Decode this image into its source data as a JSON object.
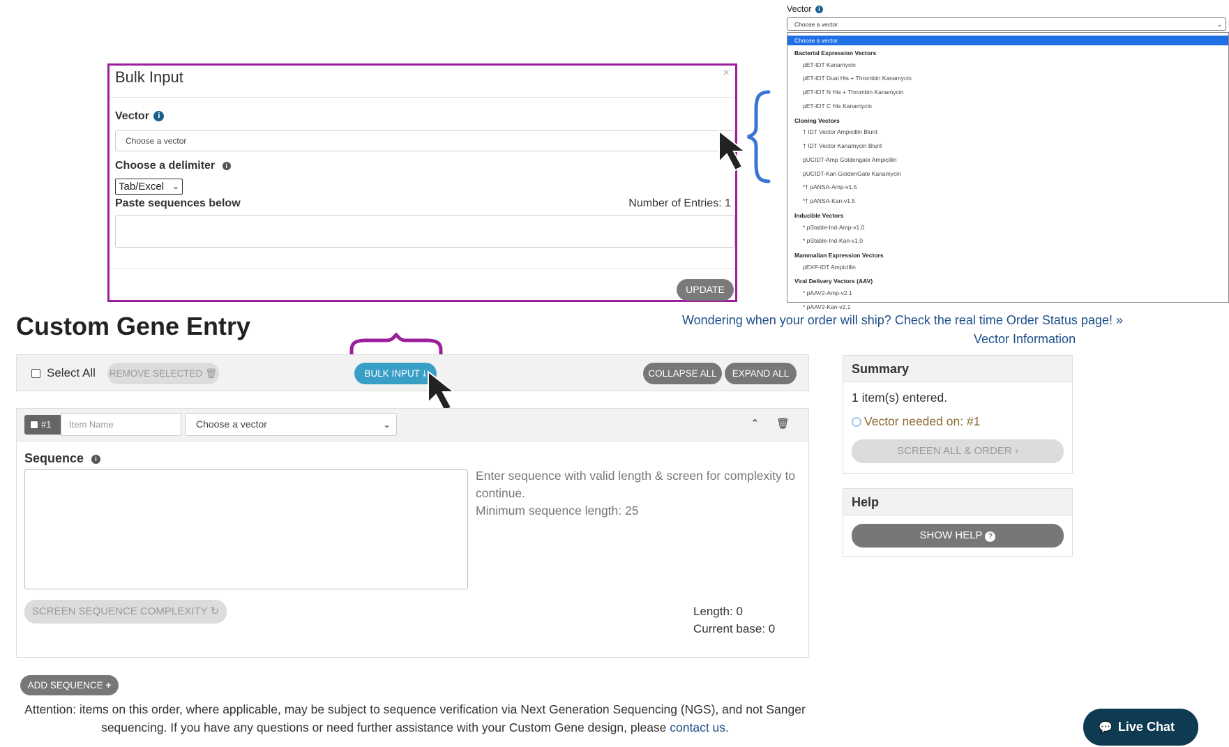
{
  "dropdown_callout": {
    "label": "Vector",
    "selected_value": "Choose a vector",
    "options": [
      {
        "kind": "selected",
        "text": "Choose a vector"
      },
      {
        "kind": "group",
        "text": "Bacterial Expression Vectors"
      },
      {
        "kind": "item",
        "text": "pET-IDT Kanamycin"
      },
      {
        "kind": "item",
        "text": "pET-IDT Dual His + Thrombin Kanamycin"
      },
      {
        "kind": "item",
        "text": "pET-IDT N His + Thrombin Kanamycin"
      },
      {
        "kind": "item",
        "text": "pET-IDT C His Kanamycin"
      },
      {
        "kind": "group",
        "text": "Cloning Vectors"
      },
      {
        "kind": "item",
        "text": "† IDT Vector Ampicillin Blunt"
      },
      {
        "kind": "item",
        "text": "† IDT Vector Kanamycin Blunt"
      },
      {
        "kind": "item",
        "text": "pUCIDT-Amp Goldengate Ampicillin"
      },
      {
        "kind": "item",
        "text": "pUCIDT-Kan GoldenGate Kanamycin"
      },
      {
        "kind": "item",
        "text": "*† pANSA-Amp-v1.5"
      },
      {
        "kind": "item",
        "text": "*† pANSA-Kan-v1.5"
      },
      {
        "kind": "group",
        "text": "Inducible Vectors"
      },
      {
        "kind": "item",
        "text": "* pStable-Ind-Amp-v1.0"
      },
      {
        "kind": "item",
        "text": "* pStable-Ind-Kan-v1.0"
      },
      {
        "kind": "group",
        "text": "Mammalian Expression Vectors"
      },
      {
        "kind": "item",
        "text": "pEXP-IDT Ampicillin"
      },
      {
        "kind": "group",
        "text": "Viral Delivery Vectors (AAV)"
      },
      {
        "kind": "item",
        "text": "* pAAV2-Amp-v2.1"
      },
      {
        "kind": "item",
        "text": "* pAAV2-Kan-v2.1"
      }
    ]
  },
  "bulk_modal": {
    "title": "Bulk Input",
    "close": "×",
    "vector_label": "Vector",
    "vector_placeholder": "Choose a vector",
    "delimiter_label": "Choose a delimiter",
    "delimiter_value": "Tab/Excel",
    "paste_label": "Paste sequences below",
    "entries": "Number of Entries: 1",
    "update_label": "UPDATE"
  },
  "page": {
    "title": "Custom Gene Entry",
    "ship_link": "Wondering when your order will ship? Check the real time Order Status page! »",
    "vector_info_link": "Vector Information"
  },
  "toolbar": {
    "select_all": "Select All",
    "remove_selected": "REMOVE SELECTED",
    "bulk_input": "BULK INPUT",
    "collapse_all": "COLLAPSE ALL",
    "expand_all": "EXPAND ALL"
  },
  "item": {
    "badge": "#1",
    "name_placeholder": "Item Name",
    "vector_value": "Choose a vector",
    "sequence_label": "Sequence",
    "hint_line1": "Enter sequence with valid length & screen for complexity to",
    "hint_line2": "continue.",
    "hint_line3": "Minimum sequence length: 25",
    "screen_btn": "SCREEN SEQUENCE COMPLEXITY",
    "length": "Length: 0",
    "current_base": "Current base: 0"
  },
  "summary": {
    "title": "Summary",
    "entered": "1 item(s) entered.",
    "vector_needed": "Vector needed on: #1",
    "screen_all": "SCREEN ALL & ORDER"
  },
  "help": {
    "title": "Help",
    "show_help": "SHOW HELP"
  },
  "add_sequence": "ADD SEQUENCE",
  "attention": {
    "text_before": "Attention: items on this order, where applicable, may be subject to sequence verification via Next Generation Sequencing (NGS), and not Sanger sequencing. If you have any questions or need further assistance with your Custom Gene design, please ",
    "link": "contact us",
    "text_after": "."
  },
  "live_chat": "Live Chat",
  "colors": {
    "callout_purple": "#9b1f9b",
    "callout_blue": "#3b74d4",
    "accent_blue": "#3a9fc6",
    "link_blue": "#1c4f8a",
    "chat_bg": "#0e3a52"
  }
}
